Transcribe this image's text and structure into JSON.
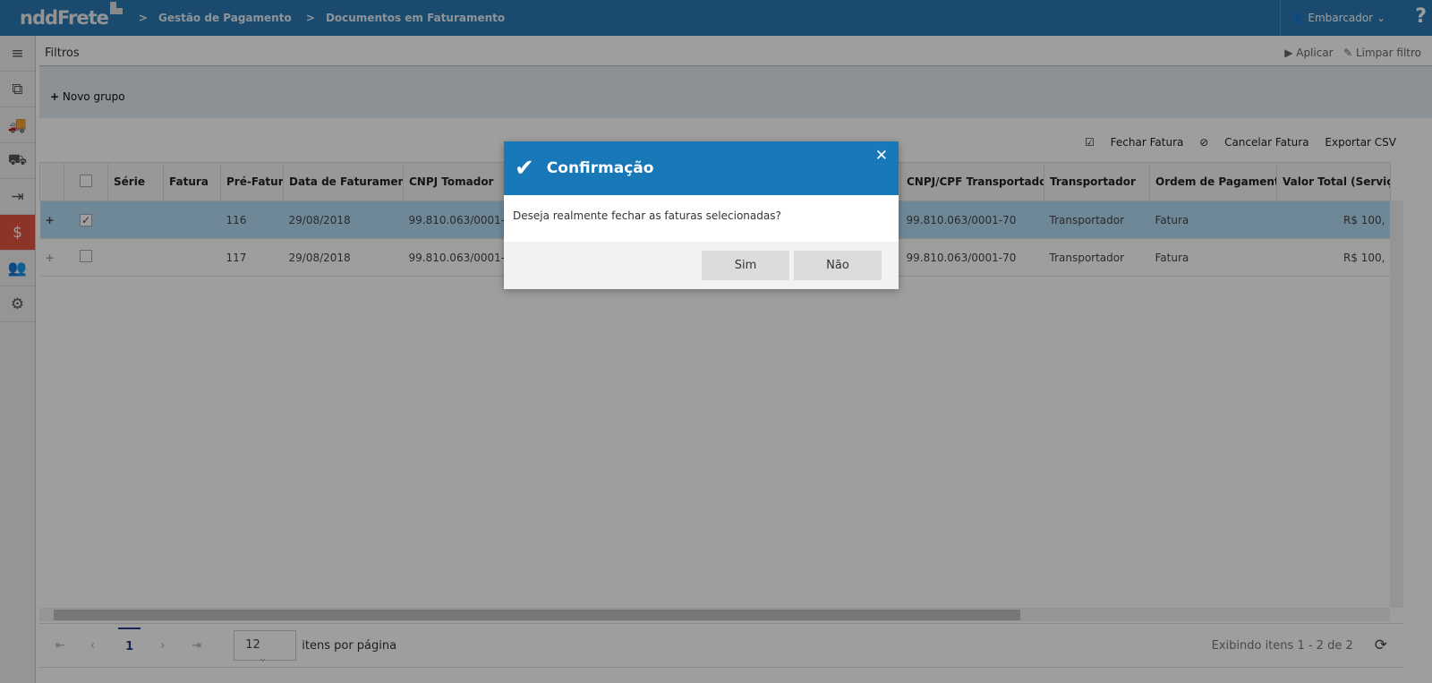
{
  "header": {
    "logo": "nddFrete",
    "breadcrumb": [
      "Gestão de Pagamento",
      "Documentos em Faturamento"
    ],
    "user": "Embarcador",
    "help": "?"
  },
  "filters": {
    "title": "Filtros",
    "apply": "Aplicar",
    "clear": "Limpar filtro",
    "new_group": "Novo grupo"
  },
  "toolbar": {
    "close_invoice": "Fechar Fatura",
    "cancel_invoice": "Cancelar Fatura",
    "export": "Exportar CSV"
  },
  "table": {
    "columns": [
      "Série",
      "Fatura",
      "Pré-Fatura",
      "Data de Faturamento",
      "CNPJ Tomador",
      "CNPJ/CPF Transportador",
      "Transportador",
      "Ordem de Pagamento",
      "Valor Total (Serviço"
    ],
    "rows": [
      {
        "pre": "116",
        "date": "29/08/2018",
        "cnpj_t": "99.810.063/0001-70",
        "cnpj_tr": "99.810.063/0001-70",
        "transp": "Transportador",
        "ordem": "Fatura",
        "valor": "R$ 100,"
      },
      {
        "pre": "117",
        "date": "29/08/2018",
        "cnpj_t": "99.810.063/0001-70",
        "cnpj_tr": "99.810.063/0001-70",
        "transp": "Transportador",
        "ordem": "Fatura",
        "valor": "R$ 100,"
      }
    ]
  },
  "pager": {
    "page": "1",
    "page_size": "12",
    "per_page_label": "itens por página",
    "summary": "Exibindo itens 1 - 2 de 2"
  },
  "modal": {
    "title": "Confirmação",
    "message": "Deseja realmente fechar as faturas selecionadas?",
    "yes": "Sim",
    "no": "Não"
  }
}
